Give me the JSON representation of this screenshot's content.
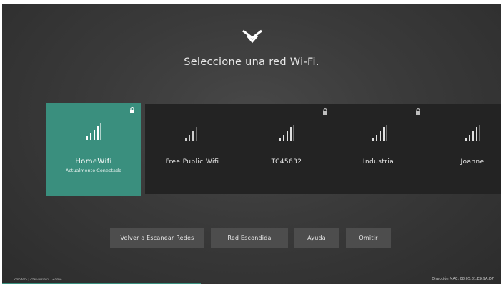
{
  "screen": {
    "title": "Seleccione una red Wi-Fi."
  },
  "networks": [
    {
      "name": "HomeWifi",
      "status": "Actualmente Conectado",
      "locked": true,
      "selected": true
    },
    {
      "name": "Free Public Wifi",
      "status": "",
      "locked": false,
      "selected": false
    },
    {
      "name": "TC45632",
      "status": "",
      "locked": true,
      "selected": false
    },
    {
      "name": "Industrial",
      "status": "",
      "locked": true,
      "selected": false
    },
    {
      "name": "Joanne",
      "status": "",
      "locked": false,
      "selected": false
    }
  ],
  "actions": {
    "rescan": "Volver a Escanear Redes",
    "hidden": "Red Escondida",
    "help": "Ayuda",
    "skip": "Omitir"
  },
  "footer": {
    "left": "<model> | <fw version> | <oobe",
    "right": "Dirección MAC: 08:05:81:E9:9A:D7"
  },
  "colors": {
    "accent": "#3a8f7e",
    "card": "#232323",
    "button": "#4d4d4d"
  },
  "icons": {
    "logo": "vizio-v-logo-icon",
    "signal": "wifi-signal-bars-icon",
    "lock": "lock-icon"
  }
}
